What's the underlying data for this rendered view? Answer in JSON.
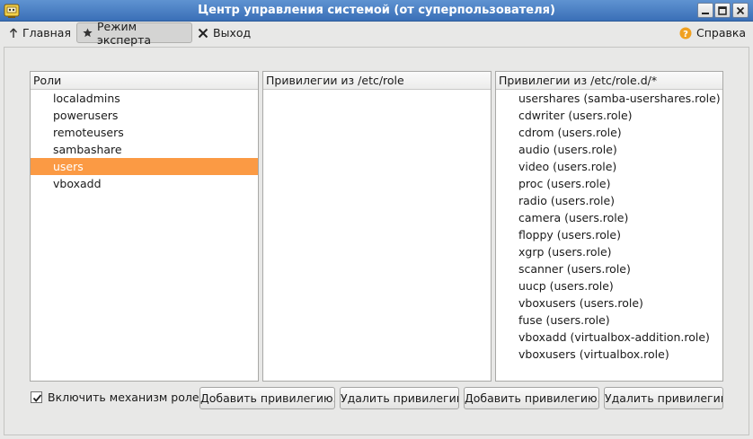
{
  "window": {
    "title": "Центр управления системой (от суперпользователя)"
  },
  "toolbar": {
    "home_label": "Главная",
    "expert_label": "Режим эксперта",
    "exit_label": "Выход",
    "help_label": "Справка"
  },
  "roles_panel": {
    "header": "Роли",
    "items": [
      {
        "label": "localadmins",
        "selected": false
      },
      {
        "label": "powerusers",
        "selected": false
      },
      {
        "label": "remoteusers",
        "selected": false
      },
      {
        "label": "sambashare",
        "selected": false
      },
      {
        "label": "users",
        "selected": true
      },
      {
        "label": "vboxadd",
        "selected": false
      }
    ]
  },
  "etc_role_panel": {
    "header": "Привилегии из /etc/role",
    "items": []
  },
  "role_d_panel": {
    "header": "Привилегии из /etc/role.d/*",
    "items": [
      "usershares (samba-usershares.role)",
      "cdwriter (users.role)",
      "cdrom (users.role)",
      "audio (users.role)",
      "video (users.role)",
      "proc (users.role)",
      "radio (users.role)",
      "camera (users.role)",
      "floppy (users.role)",
      "xgrp (users.role)",
      "scanner (users.role)",
      "uucp (users.role)",
      "vboxusers (users.role)",
      "fuse (users.role)",
      "vboxadd (virtualbox-addition.role)",
      "vboxusers (virtualbox.role)"
    ]
  },
  "bottom": {
    "enable_roles_label": "Включить механизм ролей",
    "enable_roles_checked": true,
    "add_privilege_1": "Добавить привилегию...",
    "remove_privilege_1": "Удалить привилегию",
    "add_privilege_2": "Добавить привилегию...",
    "remove_privilege_2": "Удалить привилегию"
  },
  "colors": {
    "titlebar": "#3a6fb7",
    "selection": "#fb9a44",
    "help_icon": "#f0a020"
  }
}
